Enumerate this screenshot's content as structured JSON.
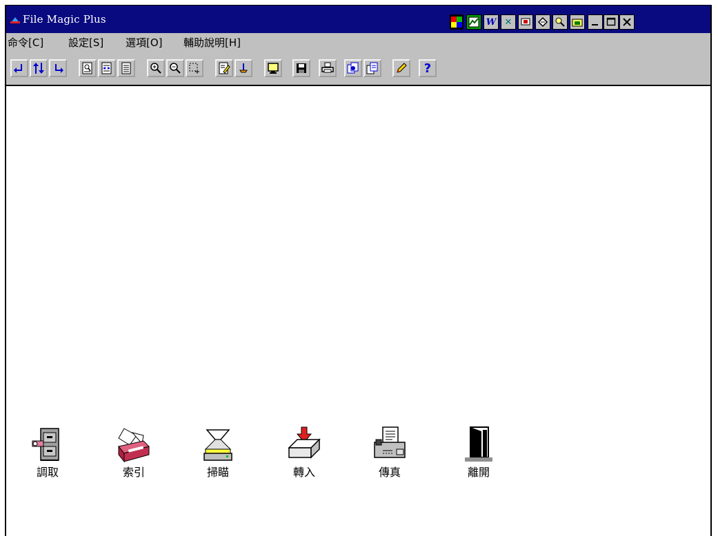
{
  "window": {
    "title": "File Magic Plus"
  },
  "menu": [
    "命令[C]",
    "設定[S]",
    "選項[O]",
    "輔助說明[H]"
  ],
  "bottom_actions": [
    {
      "label": "調取",
      "icon": "file-cabinet-icon"
    },
    {
      "label": "索引",
      "icon": "index-card-box-icon"
    },
    {
      "label": "掃瞄",
      "icon": "scanner-icon"
    },
    {
      "label": "轉入",
      "icon": "import-tray-icon"
    },
    {
      "label": "傳真",
      "icon": "fax-machine-icon"
    },
    {
      "label": "離開",
      "icon": "exit-door-icon"
    }
  ],
  "titlebar_buttons": [
    "color-palette-icon",
    "chart-app-icon",
    "word-app-icon",
    "excel-app-icon",
    "screen-app-icon",
    "tool-app-icon",
    "search-app-icon",
    "folder-app-icon",
    "minimize-icon",
    "maximize-icon",
    "close-icon"
  ],
  "toolbar_buttons": [
    "arrow-left-icon",
    "arrow-updown-icon",
    "arrow-right-icon",
    "page-view-icon",
    "fit-page-icon",
    "list-page-icon",
    "zoom-in-icon",
    "zoom-out-icon",
    "select-region-icon",
    "edit-note-icon",
    "pin-icon",
    "monitor-icon",
    "save-icon",
    "print-icon",
    "batch-icon",
    "copy-pages-icon",
    "pencil-icon",
    "help-icon"
  ],
  "colors": {
    "titlebar": "#0a0a80",
    "chrome": "#c0c0c0",
    "accent_blue": "#0000d0"
  }
}
